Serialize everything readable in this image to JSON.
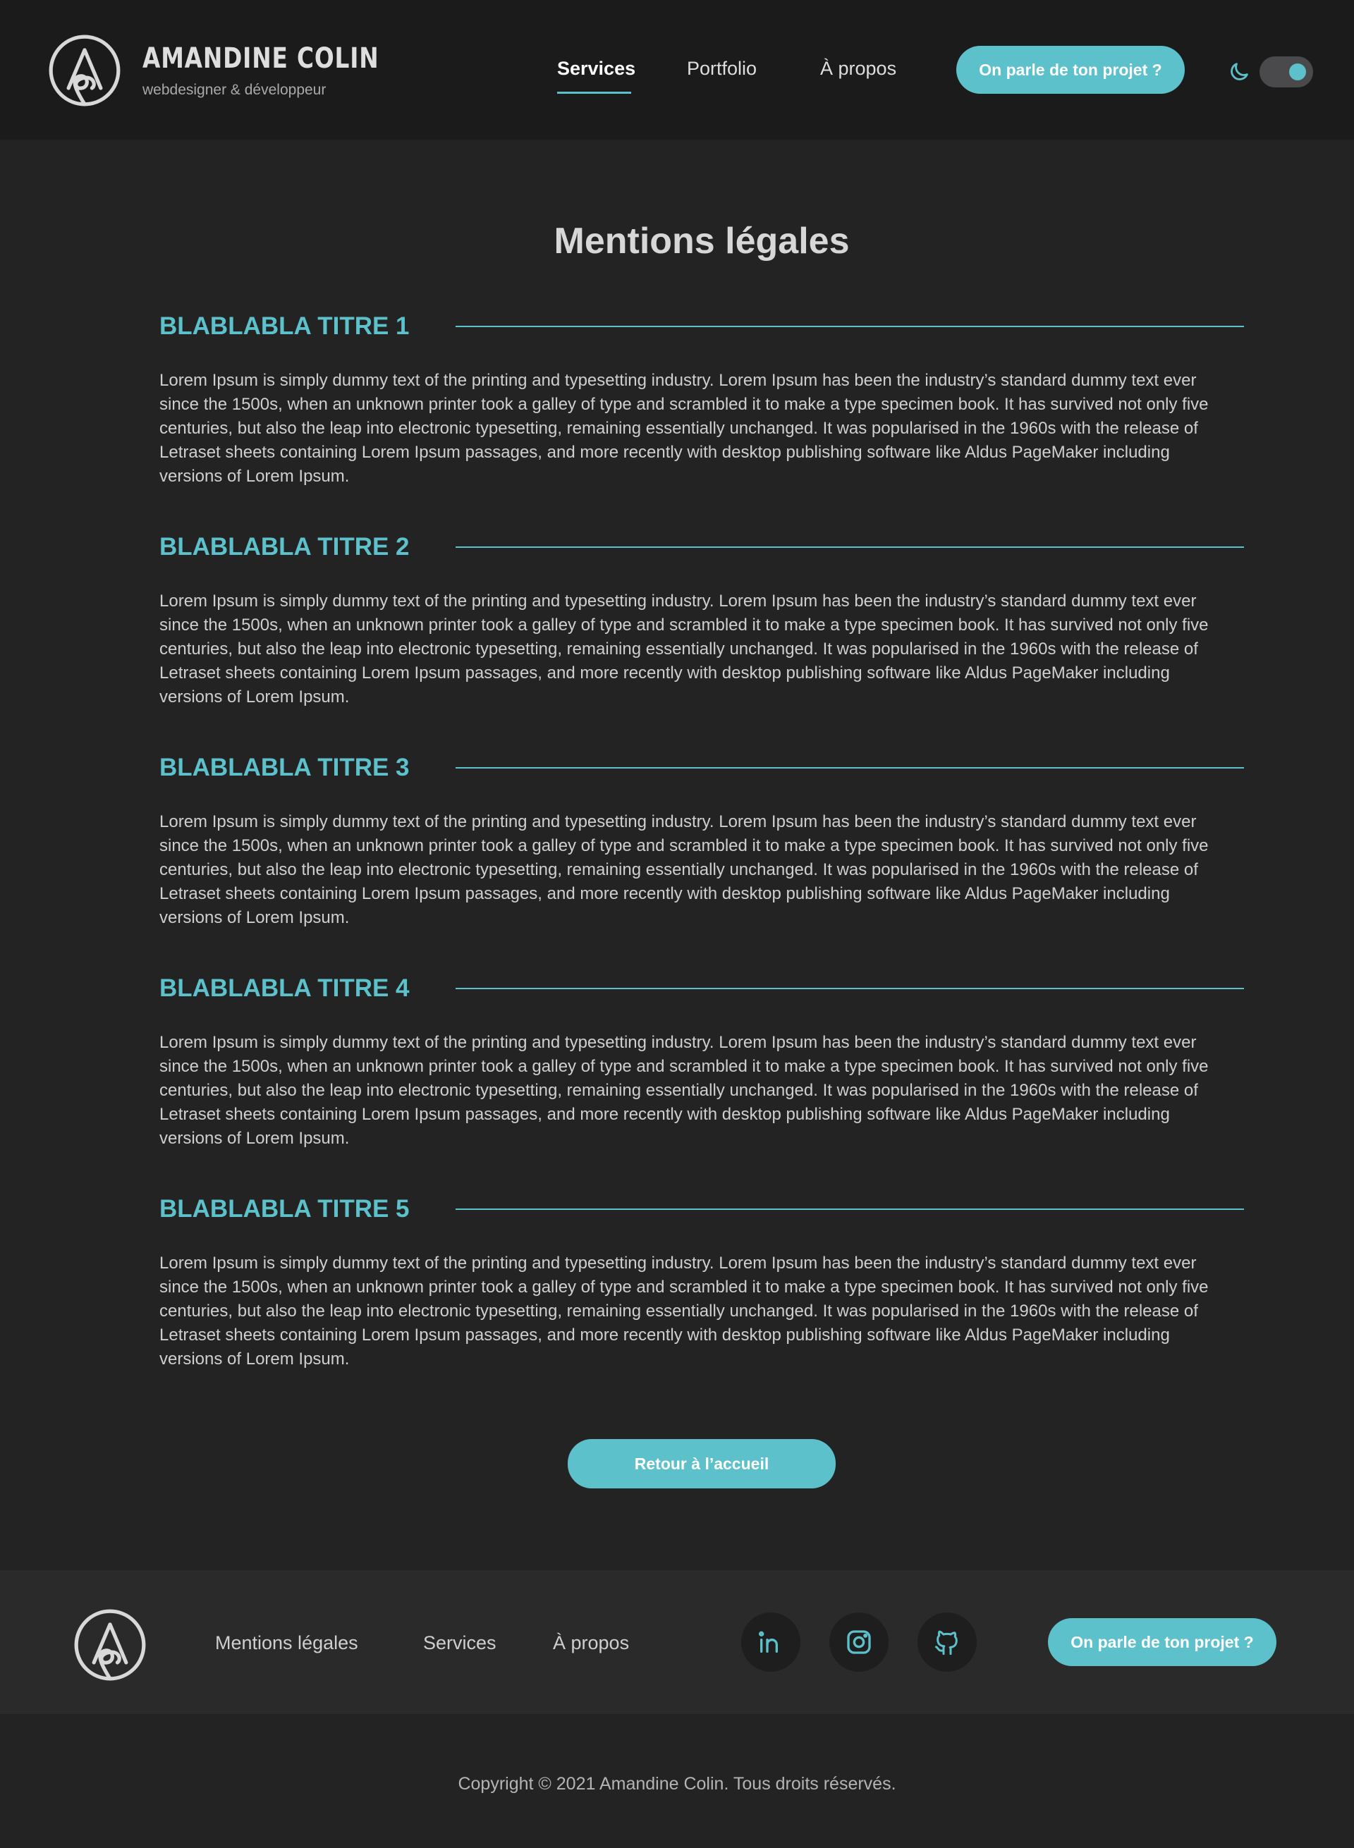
{
  "brand": {
    "name": "AMANDINE COLIN",
    "tagline": "webdesigner & développeur"
  },
  "nav": {
    "items": [
      {
        "label": "Services",
        "active": true
      },
      {
        "label": "Portfolio",
        "active": false
      },
      {
        "label": "À propos",
        "active": false
      }
    ],
    "cta_label": "On parle de ton projet ?",
    "theme_toggle": {
      "icon": "moon-icon",
      "state": "on"
    }
  },
  "main": {
    "title": "Mentions légales",
    "sections": [
      {
        "heading": "BLABLABLA TITRE 1",
        "body": "Lorem Ipsum is simply dummy text of the printing and typesetting industry. Lorem Ipsum has been the industry’s standard dummy text ever since the 1500s, when an unknown printer took a galley of type and scrambled it to make a type specimen book. It has survived not only five centuries, but also the leap into electronic typesetting, remaining essentially unchanged. It was popularised in the 1960s with the release of Letraset sheets containing Lorem Ipsum passages, and more recently with desktop publishing software like Aldus PageMaker including versions of Lorem Ipsum."
      },
      {
        "heading": "BLABLABLA TITRE 2",
        "body": "Lorem Ipsum is simply dummy text of the printing and typesetting industry. Lorem Ipsum has been the industry’s standard dummy text ever since the 1500s, when an unknown printer took a galley of type and scrambled it to make a type specimen book. It has survived not only five centuries, but also the leap into electronic typesetting, remaining essentially unchanged. It was popularised in the 1960s with the release of Letraset sheets containing Lorem Ipsum passages, and more recently with desktop publishing software like Aldus PageMaker including versions of Lorem Ipsum."
      },
      {
        "heading": "BLABLABLA TITRE 3",
        "body": "Lorem Ipsum is simply dummy text of the printing and typesetting industry. Lorem Ipsum has been the industry’s standard dummy text ever since the 1500s, when an unknown printer took a galley of type and scrambled it to make a type specimen book. It has survived not only five centuries, but also the leap into electronic typesetting, remaining essentially unchanged. It was popularised in the 1960s with the release of Letraset sheets containing Lorem Ipsum passages, and more recently with desktop publishing software like Aldus PageMaker including versions of Lorem Ipsum."
      },
      {
        "heading": "BLABLABLA TITRE 4",
        "body": "Lorem Ipsum is simply dummy text of the printing and typesetting industry. Lorem Ipsum has been the industry’s standard dummy text ever since the 1500s, when an unknown printer took a galley of type and scrambled it to make a type specimen book. It has survived not only five centuries, but also the leap into electronic typesetting, remaining essentially unchanged. It was popularised in the 1960s with the release of Letraset sheets containing Lorem Ipsum passages, and more recently with desktop publishing software like Aldus PageMaker including versions of Lorem Ipsum."
      },
      {
        "heading": "BLABLABLA TITRE 5",
        "body": "Lorem Ipsum is simply dummy text of the printing and typesetting industry. Lorem Ipsum has been the industry’s standard dummy text ever since the 1500s, when an unknown printer took a galley of type and scrambled it to make a type specimen book. It has survived not only five centuries, but also the leap into electronic typesetting, remaining essentially unchanged. It was popularised in the 1960s with the release of Letraset sheets containing Lorem Ipsum passages, and more recently with desktop publishing software like Aldus PageMaker including versions of Lorem Ipsum."
      }
    ],
    "back_label": "Retour à l’accueil"
  },
  "footer": {
    "links": [
      "Mentions légales",
      "Services",
      "À propos"
    ],
    "socials": [
      "linkedin-icon",
      "instagram-icon",
      "github-icon"
    ],
    "cta_label": "On parle de ton projet ?",
    "copyright": "Copyright © 2021 Amandine Colin. Tous droits réservés."
  },
  "colors": {
    "accent": "#5cc1cb",
    "header_bg": "#1b1b1c",
    "page_bg": "#232324",
    "footer_bg": "#2a2a2b"
  }
}
